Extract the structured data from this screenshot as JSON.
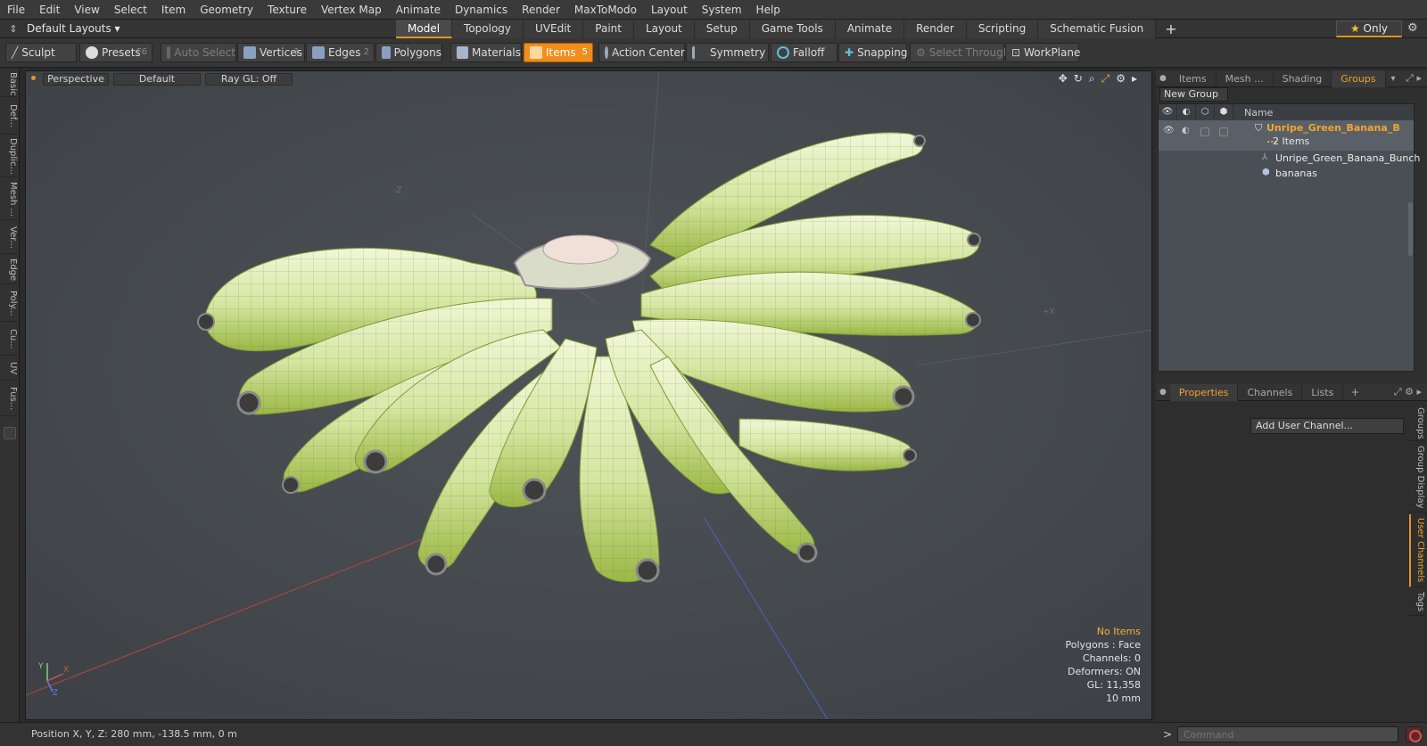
{
  "menu": [
    "File",
    "Edit",
    "View",
    "Select",
    "Item",
    "Geometry",
    "Texture",
    "Vertex Map",
    "Animate",
    "Dynamics",
    "Render",
    "MaxToModo",
    "Layout",
    "System",
    "Help"
  ],
  "layout_selector": "Default Layouts",
  "layout_tabs": [
    {
      "label": "Model",
      "active": true
    },
    {
      "label": "Topology"
    },
    {
      "label": "UVEdit"
    },
    {
      "label": "Paint"
    },
    {
      "label": "Layout"
    },
    {
      "label": "Setup"
    },
    {
      "label": "Game Tools"
    },
    {
      "label": "Animate"
    },
    {
      "label": "Render"
    },
    {
      "label": "Scripting"
    },
    {
      "label": "Schematic Fusion"
    }
  ],
  "only_label": "Only",
  "toolbar": {
    "sculpt": "Sculpt",
    "presets": "Presets",
    "presets_key": "F6",
    "auto_select": "Auto Select",
    "vertices": "Vertices",
    "vertices_key": "1",
    "edges": "Edges",
    "edges_key": "2",
    "polygons": "Polygons",
    "materials": "Materials",
    "items": "Items",
    "items_key": "5",
    "action_center": "Action Center",
    "symmetry": "Symmetry",
    "falloff": "Falloff",
    "snapping": "Snapping",
    "select_through": "Select Through",
    "workplane": "WorkPlane"
  },
  "left_tabs": [
    "Basic",
    "Def...",
    "Duplic...",
    "Mesh ...",
    "Ver...",
    "Edge",
    "Poly...",
    "Cu...",
    "UV",
    "Fus..."
  ],
  "viewport": {
    "view": "Perspective",
    "shading": "Default",
    "raygl": "Ray GL: Off",
    "hud": {
      "selection": "No Items",
      "polygons": "Polygons : Face",
      "channels": "Channels: 0",
      "deformers": "Deformers: ON",
      "gl": "GL: 11,358",
      "unit": "10 mm"
    },
    "axis_labels": {
      "y": "Y",
      "x": "X",
      "z": "Z"
    },
    "neg_z": "-Z",
    "pos_x": "+X"
  },
  "groups_panel": {
    "tabs": [
      "Items",
      "Mesh ...",
      "Shading",
      "Groups"
    ],
    "new_group": "New Group",
    "name_header": "Name",
    "group_name": "Unripe_Green_Banana_B ...",
    "group_count": "2 Items",
    "children": [
      "Unripe_Green_Banana_Bunch",
      "bananas"
    ]
  },
  "props_panel": {
    "tabs": [
      "Properties",
      "Channels",
      "Lists"
    ],
    "add_channel": "Add User Channel...",
    "side_tabs": [
      "Groups",
      "Group Display",
      "User Channels",
      "Tags"
    ]
  },
  "status": {
    "position": "Position X, Y, Z:  280 mm, -138.5 mm, 0 m"
  },
  "command_placeholder": "Command",
  "colors": {
    "accent": "#e8931f",
    "banana_light": "#e9f2c6",
    "banana_dark": "#a7c24a",
    "viewport_bg": "#484c50"
  }
}
